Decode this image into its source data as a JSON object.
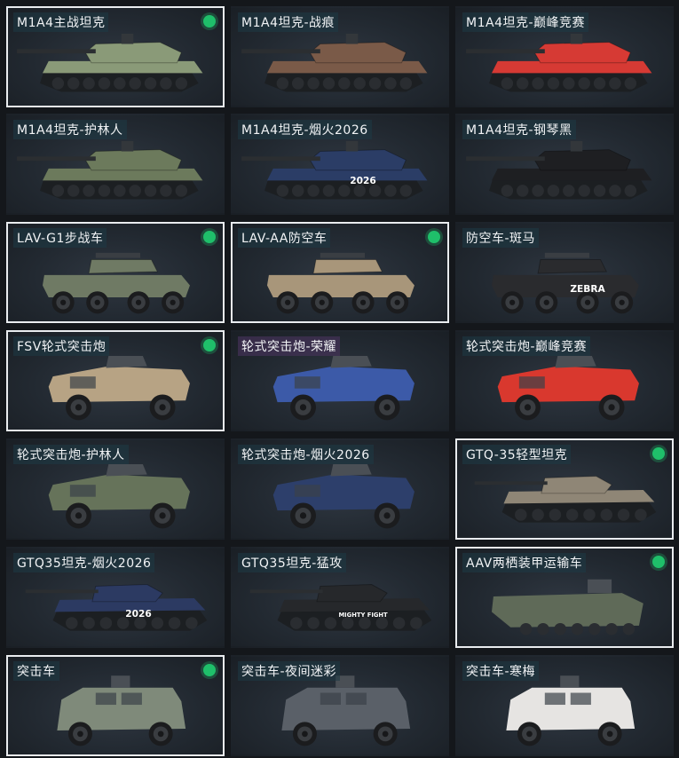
{
  "vehicles": [
    {
      "name": "M1A4主战坦克",
      "kind": "tank",
      "camo": "desert-green",
      "selected": true,
      "owned": true,
      "accent": "#8a9a78"
    },
    {
      "name": "M1A4坦克-战痕",
      "kind": "tank",
      "camo": "rust",
      "selected": false,
      "owned": false,
      "accent": "#7a5a48"
    },
    {
      "name": "M1A4坦克-巅峰竞赛",
      "kind": "tank",
      "camo": "red-white",
      "selected": false,
      "owned": false,
      "accent": "#d63a34"
    },
    {
      "name": "M1A4坦克-护林人",
      "kind": "tank",
      "camo": "forest",
      "selected": false,
      "owned": false,
      "accent": "#6c7a5c"
    },
    {
      "name": "M1A4坦克-烟火2026",
      "kind": "tank",
      "camo": "navy",
      "selected": false,
      "owned": false,
      "accent": "#2b3d66",
      "deco": "2026"
    },
    {
      "name": "M1A4坦克-钢琴黑",
      "kind": "tank",
      "camo": "black",
      "selected": false,
      "owned": false,
      "accent": "#1e1f22"
    },
    {
      "name": "LAV-G1步战车",
      "kind": "apc",
      "camo": "green",
      "selected": true,
      "owned": true,
      "accent": "#6f7a64"
    },
    {
      "name": "LAV-AA防空车",
      "kind": "apc",
      "camo": "sand",
      "selected": true,
      "owned": true,
      "accent": "#a8967a"
    },
    {
      "name": "防空车-斑马",
      "kind": "apc",
      "camo": "zebra",
      "selected": false,
      "owned": false,
      "accent": "#2a2b2e",
      "deco": "ZEBRA"
    },
    {
      "name": "FSV轮式突击炮",
      "kind": "armored",
      "camo": "tan",
      "selected": true,
      "owned": true,
      "accent": "#b7a384"
    },
    {
      "name": "轮式突击炮-荣耀",
      "kind": "armored",
      "camo": "blue",
      "selected": false,
      "owned": false,
      "accent": "#3c5aa8",
      "purple": true
    },
    {
      "name": "轮式突击炮-巅峰竞赛",
      "kind": "armored",
      "camo": "red",
      "selected": false,
      "owned": false,
      "accent": "#d9382e"
    },
    {
      "name": "轮式突击炮-护林人",
      "kind": "armored",
      "camo": "forest",
      "selected": false,
      "owned": false,
      "accent": "#66735a"
    },
    {
      "name": "轮式突击炮-烟火2026",
      "kind": "armored",
      "camo": "navy",
      "selected": false,
      "owned": false,
      "accent": "#2d3f6b"
    },
    {
      "name": "GTQ-35轻型坦克",
      "kind": "light",
      "camo": "tan",
      "selected": true,
      "owned": true,
      "accent": "#8f8676"
    },
    {
      "name": "GTQ35坦克-烟火2026",
      "kind": "light",
      "camo": "navy",
      "selected": false,
      "owned": false,
      "accent": "#2c3a62",
      "deco": "2026"
    },
    {
      "name": "GTQ35坦克-猛攻",
      "kind": "light",
      "camo": "black-red",
      "selected": false,
      "owned": false,
      "accent": "#26282b",
      "deco": "MIGHTY FIGHT"
    },
    {
      "name": "AAV两栖装甲运输车",
      "kind": "amph",
      "camo": "olive",
      "selected": true,
      "owned": true,
      "accent": "#5f6a58"
    },
    {
      "name": "突击车",
      "kind": "mrap",
      "camo": "urban-green",
      "selected": true,
      "owned": true,
      "accent": "#7f8a7a"
    },
    {
      "name": "突击车-夜间迷彩",
      "kind": "mrap",
      "camo": "night",
      "selected": false,
      "owned": false,
      "accent": "#5a6068"
    },
    {
      "name": "突击车-寒梅",
      "kind": "mrap",
      "camo": "white-red",
      "selected": false,
      "owned": false,
      "accent": "#e6e4e2"
    }
  ]
}
